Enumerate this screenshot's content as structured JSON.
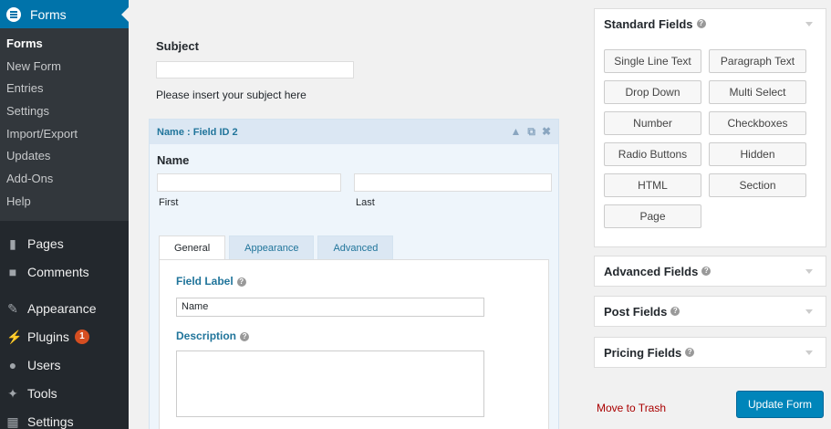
{
  "sidebar": {
    "header": "Forms",
    "submenu": [
      "Forms",
      "New Form",
      "Entries",
      "Settings",
      "Import/Export",
      "Updates",
      "Add-Ons",
      "Help"
    ],
    "menu": [
      {
        "label": "Pages",
        "icon": "pages-icon"
      },
      {
        "label": "Comments",
        "icon": "comments-icon"
      },
      {
        "label": "Appearance",
        "icon": "appearance-icon"
      },
      {
        "label": "Plugins",
        "icon": "plugins-icon",
        "badge": "1"
      },
      {
        "label": "Users",
        "icon": "users-icon"
      },
      {
        "label": "Tools",
        "icon": "tools-icon"
      },
      {
        "label": "Settings",
        "icon": "settings-icon"
      }
    ]
  },
  "subject": {
    "label": "Subject",
    "description": "Please insert your subject here"
  },
  "field": {
    "header": "Name : Field ID 2",
    "label": "Name",
    "first": "First",
    "last": "Last",
    "tabs": [
      "General",
      "Appearance",
      "Advanced"
    ],
    "field_label": "Field Label",
    "field_label_value": "Name",
    "description": "Description"
  },
  "panels": {
    "standard": "Standard Fields",
    "advanced": "Advanced Fields",
    "post": "Post Fields",
    "pricing": "Pricing Fields",
    "buttons": [
      "Single Line Text",
      "Paragraph Text",
      "Drop Down",
      "Multi Select",
      "Number",
      "Checkboxes",
      "Radio Buttons",
      "Hidden",
      "HTML",
      "Section",
      "Page"
    ]
  },
  "actions": {
    "trash": "Move to Trash",
    "update": "Update Form"
  }
}
